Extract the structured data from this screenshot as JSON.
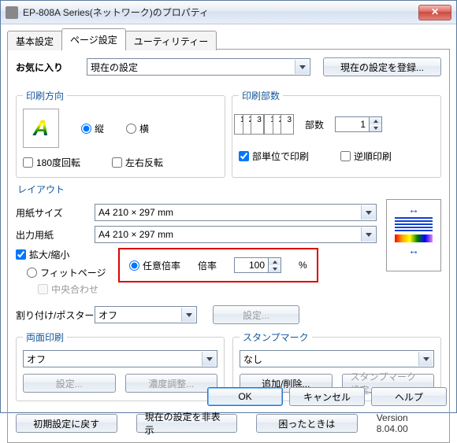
{
  "window": {
    "title": "EP-808A Series(ネットワーク)のプロパティ"
  },
  "tabs": {
    "basic": "基本設定",
    "page": "ページ設定",
    "utility": "ユーティリティー"
  },
  "favorites": {
    "label": "お気に入り",
    "value": "現在の設定",
    "register_btn": "現在の設定を登録..."
  },
  "orientation": {
    "legend": "印刷方向",
    "portrait": "縦",
    "landscape": "横",
    "rotate180": "180度回転",
    "mirror": "左右反転"
  },
  "copies": {
    "legend": "印刷部数",
    "copies_label": "部数",
    "copies_value": "1",
    "collate": "部単位で印刷",
    "reverse": "逆順印刷"
  },
  "layout": {
    "label": "レイアウト",
    "paper_size_label": "用紙サイズ",
    "paper_size_value": "A4 210 × 297 mm",
    "output_size_label": "出力用紙",
    "output_size_value": "A4 210 × 297 mm"
  },
  "scale": {
    "enlarge_reduce": "拡大/縮小",
    "fit_page": "フィットページ",
    "center": "中央合わせ",
    "custom_ratio": "任意倍率",
    "ratio_label": "倍率",
    "ratio_value": "100",
    "ratio_unit": "%"
  },
  "multi": {
    "label": "割り付け/ポスター",
    "value": "オフ",
    "settings_btn": "設定..."
  },
  "duplex": {
    "legend": "両面印刷",
    "value": "オフ",
    "settings_btn": "設定...",
    "density_btn": "濃度調整..."
  },
  "watermark": {
    "legend": "スタンプマーク",
    "value": "なし",
    "add_remove_btn": "追加/削除...",
    "settings_btn": "スタンプマーク設定..."
  },
  "lower": {
    "reset_btn": "初期設定に戻す",
    "hide_settings_btn": "現在の設定を非表示",
    "help_guide_btn": "困ったときは",
    "version": "Version 8.04.00"
  },
  "dialog": {
    "ok": "OK",
    "cancel": "キャンセル",
    "help": "ヘルプ"
  }
}
